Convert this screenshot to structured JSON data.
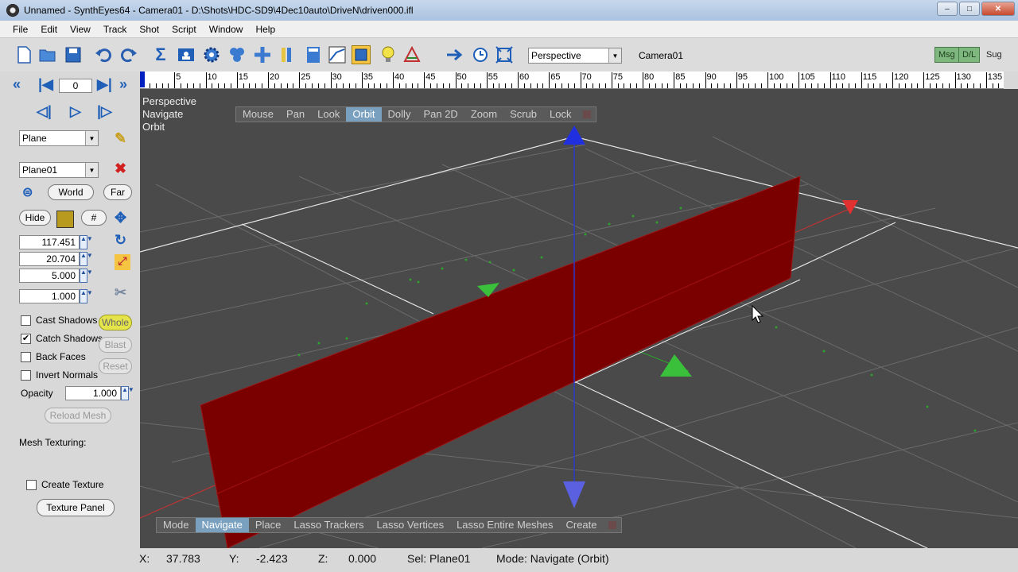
{
  "window": {
    "title": "Unnamed - SynthEyes64 - Camera01 - D:\\Shots\\HDC-SD9\\4Dec10auto\\DriveN\\driven000.ifl",
    "minimize": "–",
    "maximize": "□",
    "close": "✕"
  },
  "menu": [
    "File",
    "Edit",
    "View",
    "Track",
    "Shot",
    "Script",
    "Window",
    "Help"
  ],
  "toolbar": {
    "view_select": "Perspective",
    "camera_label": "Camera01",
    "msg": "Msg",
    "dl": "D/L",
    "sug": "Sug"
  },
  "timeline": {
    "current_frame": "0",
    "ticks": [
      "5",
      "10",
      "15",
      "20",
      "25",
      "30",
      "35",
      "40",
      "45",
      "50",
      "55",
      "60",
      "65",
      "70",
      "75",
      "80",
      "85",
      "90",
      "95",
      "100",
      "105",
      "110",
      "115",
      "120",
      "125",
      "130",
      "135"
    ]
  },
  "left": {
    "object_type": "Plane",
    "object_name": "Plane01",
    "world": "World",
    "far": "Far",
    "hide": "Hide",
    "hash": "#",
    "fields": [
      "117.451",
      "20.704",
      "5.000"
    ],
    "scale_field": "1.000",
    "cast_shadows": "Cast Shadows",
    "catch_shadows": "Catch Shadows",
    "back_faces": "Back Faces",
    "invert_normals": "Invert Normals",
    "whole": "Whole",
    "blast": "Blast",
    "reset": "Reset",
    "opacity_label": "Opacity",
    "opacity_value": "1.000",
    "reload_mesh": "Reload Mesh",
    "mesh_texturing": "Mesh Texturing:",
    "create_texture": "Create Texture",
    "texture_panel": "Texture Panel",
    "swatch_color": "#b89a1e"
  },
  "viewport": {
    "labels": [
      "Perspective",
      "Navigate",
      "Orbit"
    ],
    "top_bar": [
      "Mouse",
      "Pan",
      "Look",
      "Orbit",
      "Dolly",
      "Pan 2D",
      "Zoom",
      "Scrub",
      "Lock"
    ],
    "top_selected": "Orbit",
    "bottom_bar": [
      "Mode",
      "Navigate",
      "Place",
      "Lasso Trackers",
      "Lasso Vertices",
      "Lasso Entire Meshes",
      "Create"
    ],
    "bottom_selected": "Navigate",
    "plane_color": "#7a0000",
    "bg_color": "#4a4a4a"
  },
  "status": {
    "x_label": "X:",
    "x_value": "37.783",
    "y_label": "Y:",
    "y_value": "-2.423",
    "z_label": "Z:",
    "z_value": "0.000",
    "sel": "Sel: Plane01",
    "mode": "Mode: Navigate (Orbit)"
  }
}
